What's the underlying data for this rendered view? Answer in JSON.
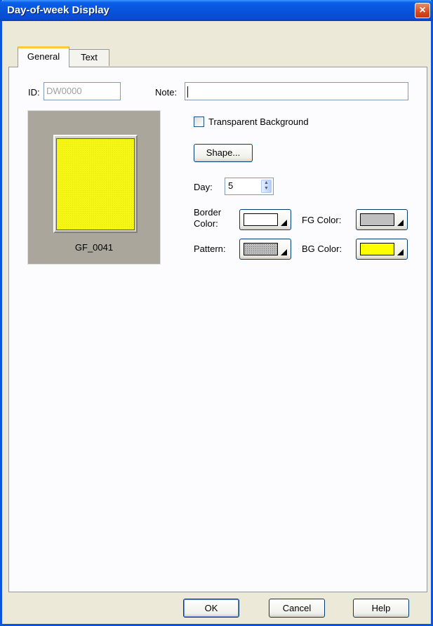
{
  "window": {
    "title": "Day-of-week Display",
    "close_icon": "×"
  },
  "tabs": [
    {
      "label": "General",
      "active": true
    },
    {
      "label": "Text",
      "active": false
    }
  ],
  "general": {
    "id_label": "ID:",
    "id_value": "DW0000",
    "note_label": "Note:",
    "note_value": "",
    "preview_caption": "GF_0041",
    "transparent_bg_label": "Transparent Background",
    "transparent_bg_checked": false,
    "shape_button": "Shape...",
    "day_label": "Day:",
    "day_value": "5",
    "border_color_label": "Border Color:",
    "border_color_line1": "Border",
    "border_color_line2": "Color:",
    "fg_color_label": "FG Color:",
    "pattern_label": "Pattern:",
    "bg_color_label": "BG Color:"
  },
  "colors": {
    "border_color": "#FFFFFF",
    "fg_color": "#C0C0C0",
    "bg_color": "#FFFF00",
    "title_bar": "#0A54E0"
  },
  "buttons": {
    "ok": "OK",
    "cancel": "Cancel",
    "help": "Help"
  }
}
